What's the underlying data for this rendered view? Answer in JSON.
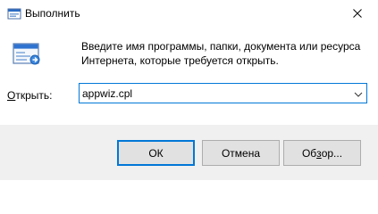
{
  "window": {
    "title": "Выполнить",
    "title_icon": "run-icon",
    "close_icon": "close-icon"
  },
  "content": {
    "icon": "run-dialog-icon",
    "description": "Введите имя программы, папки, документа или ресурса\nИнтернета, которые требуется открыть.",
    "open_label": "Открыть:",
    "open_label_accel": "О",
    "open_label_rest": "ткрыть:",
    "open_value": "appwiz.cpl",
    "dropdown_icon": "chevron-down-icon"
  },
  "buttons": {
    "ok": "ОК",
    "cancel": "Отмена",
    "browse": "Обзор...",
    "browse_pre": "Об",
    "browse_accel": "з",
    "browse_post": "ор..."
  },
  "colors": {
    "accent": "#0078d7",
    "footer_bg": "#f0f0f0",
    "button_bg": "#e1e1e1",
    "button_border": "#adadad"
  }
}
